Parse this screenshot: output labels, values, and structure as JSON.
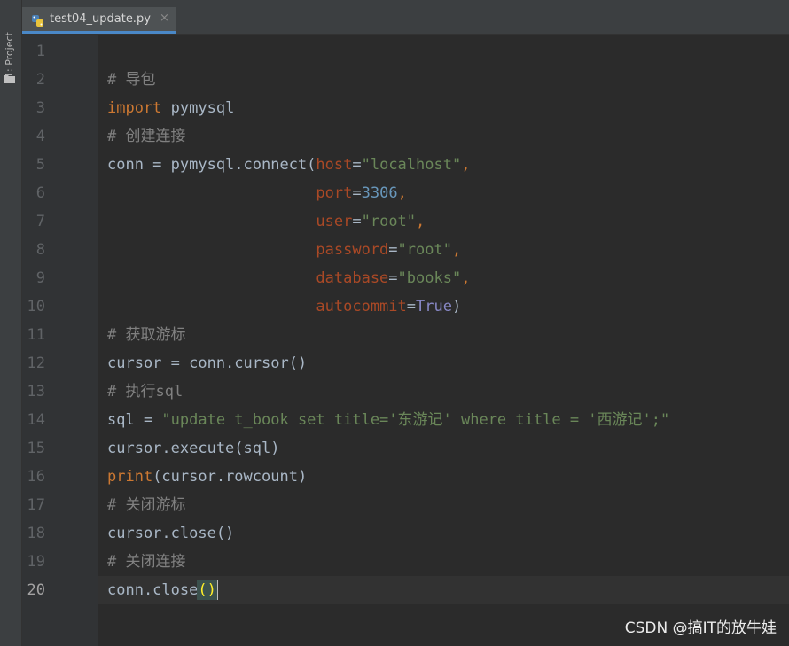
{
  "sidebar": {
    "project_tab_label": "1: Project",
    "folder_icon": "folder-icon"
  },
  "tab": {
    "file_name": "test04_update.py",
    "file_icon": "python-file-icon",
    "close_glyph": "×"
  },
  "editor": {
    "current_line": 20,
    "line_numbers": [
      "1",
      "2",
      "3",
      "4",
      "5",
      "6",
      "7",
      "8",
      "9",
      "10",
      "11",
      "12",
      "13",
      "14",
      "15",
      "16",
      "17",
      "18",
      "19",
      "20"
    ],
    "lines": {
      "l1": "",
      "l2": {
        "comment": "# 导包"
      },
      "l3": {
        "kw": "import",
        "rest": " pymysql"
      },
      "l4": {
        "comment": "# 创建连接"
      },
      "l5": {
        "a": "conn = pymysql.connect(",
        "param": "host",
        "eq": "=",
        "str": "\"localhost\"",
        "end": ","
      },
      "l6": {
        "indent": "                       ",
        "param": "port",
        "eq": "=",
        "num": "3306",
        "end": ","
      },
      "l7": {
        "indent": "                       ",
        "param": "user",
        "eq": "=",
        "str": "\"root\"",
        "end": ","
      },
      "l8": {
        "indent": "                       ",
        "param": "password",
        "eq": "=",
        "str": "\"root\"",
        "end": ","
      },
      "l9": {
        "indent": "                       ",
        "param": "database",
        "eq": "=",
        "str": "\"books\"",
        "end": ","
      },
      "l10": {
        "indent": "                       ",
        "param": "autocommit",
        "eq": "=",
        "val": "True",
        "end": ")"
      },
      "l11": {
        "comment": "# 获取游标"
      },
      "l12": {
        "code": "cursor = conn.cursor()"
      },
      "l13": {
        "comment": "# 执行sql"
      },
      "l14": {
        "a": "sql = ",
        "str": "\"update t_book set title='东游记' where title = '西游记';\""
      },
      "l15": {
        "code": "cursor.execute(sql)"
      },
      "l16": {
        "builtin": "print",
        "rest": "(cursor.rowcount)"
      },
      "l17": {
        "comment": "# 关闭游标"
      },
      "l18": {
        "code": "cursor.close()"
      },
      "l19": {
        "comment": "# 关闭连接"
      },
      "l20": {
        "a": "conn.close",
        "paren": "()"
      }
    }
  },
  "watermark": "CSDN @搞IT的放牛娃",
  "colors": {
    "background": "#2b2b2b",
    "keyword": "#cc7832",
    "comment": "#808080",
    "string": "#6a8759",
    "number": "#6897bb",
    "param": "#aa4926",
    "builtin": "#8888c6",
    "tab_underline": "#4a88c7"
  }
}
